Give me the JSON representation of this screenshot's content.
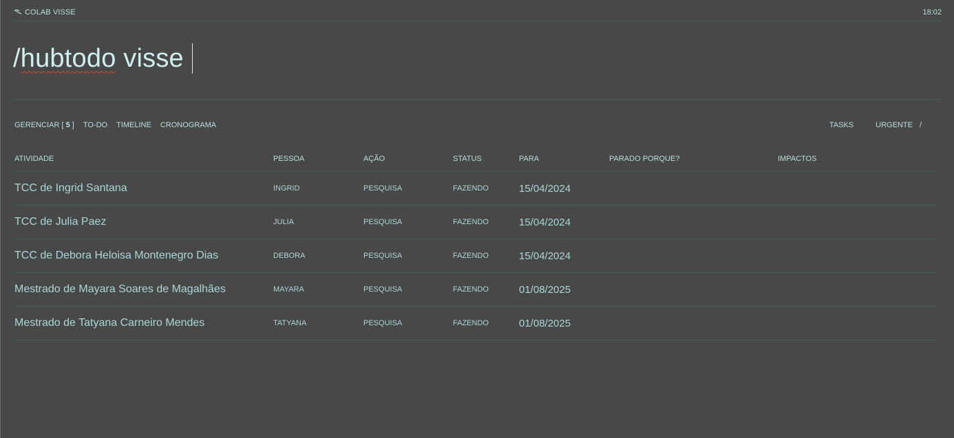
{
  "header": {
    "brand": "COLAB VISSE",
    "time": "18:02"
  },
  "command": {
    "slash": "/",
    "keyword": "hubtodo",
    "arg": " visse"
  },
  "nav": {
    "manage_label": "GERENCIAR [",
    "manage_count": "5",
    "manage_close": "]",
    "todo": "TO-DO",
    "timeline": "TIMELINE",
    "schedule": "CRONOGRAMA"
  },
  "filters": {
    "tasks": "TASKS",
    "urgent": "URGENTE",
    "slash": "/"
  },
  "table": {
    "columns": [
      "ATIVIDADE",
      "PESSOA",
      "AÇÃO",
      "STATUS",
      "PARA",
      "PARADO PORQUE?",
      "IMPACTOS"
    ],
    "rows": [
      {
        "atividade": "TCC de Ingrid Santana",
        "pessoa": "INGRID",
        "acao": "PESQUISA",
        "status": "FAZENDO",
        "para": "15/04/2024",
        "parado": "",
        "impactos": ""
      },
      {
        "atividade": "TCC de Julia Paez",
        "pessoa": "JULIA",
        "acao": "PESQUISA",
        "status": "FAZENDO",
        "para": "15/04/2024",
        "parado": "",
        "impactos": ""
      },
      {
        "atividade": "TCC de Debora Heloisa Montenegro Dias",
        "pessoa": "DEBORA",
        "acao": "PESQUISA",
        "status": "FAZENDO",
        "para": "15/04/2024",
        "parado": "",
        "impactos": ""
      },
      {
        "atividade": "Mestrado de Mayara Soares de Magalhães",
        "pessoa": "MAYARA",
        "acao": "PESQUISA",
        "status": "FAZENDO",
        "para": "01/08/2025",
        "parado": "",
        "impactos": ""
      },
      {
        "atividade": "Mestrado de Tatyana Carneiro Mendes",
        "pessoa": "TATYANA",
        "acao": "PESQUISA",
        "status": "FAZENDO",
        "para": "01/08/2025",
        "parado": "",
        "impactos": ""
      }
    ]
  },
  "colors": {
    "background": "#484848",
    "text": "#a9d6d8",
    "divider": "#3d6356",
    "spellcheck": "#d9483b"
  }
}
